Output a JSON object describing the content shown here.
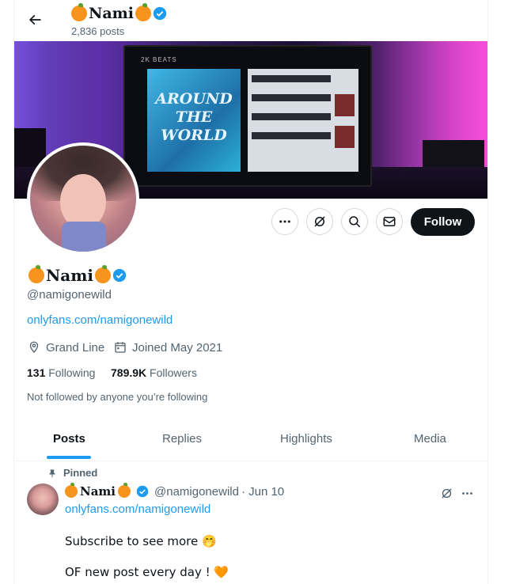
{
  "header": {
    "back_label": "←",
    "name": "Nami",
    "post_count": "2,836 posts"
  },
  "banner": {
    "monitor_top_text": "2K BEATS",
    "art_text": "AROUND THE WORLD"
  },
  "actions": {
    "more_label": "···",
    "follow_label": "Follow"
  },
  "profile": {
    "name": "Nami",
    "handle": "@namigonewild",
    "link": "onlyfans.com/namigonewild",
    "location": "Grand Line",
    "joined": "Joined May 2021",
    "following_count": "131",
    "following_label": "Following",
    "followers_count": "789.9K",
    "followers_label": "Followers",
    "not_followed": "Not followed by anyone you’re following"
  },
  "tabs": [
    {
      "label": "Posts"
    },
    {
      "label": "Replies"
    },
    {
      "label": "Highlights"
    },
    {
      "label": "Media"
    }
  ],
  "post": {
    "pinned_label": "Pinned",
    "author_name": "Nami",
    "author_handle": "@namigonewild",
    "date": "· Jun 10",
    "link": "onlyfans.com/namigonewild",
    "line1": "Subscribe to see more 🤭",
    "line2": "OF new post every day ! 🧡"
  },
  "colors": {
    "accent": "#1d9bf0",
    "text_primary": "#0f1419",
    "text_secondary": "#536471",
    "follow_bg": "#0f1419"
  }
}
